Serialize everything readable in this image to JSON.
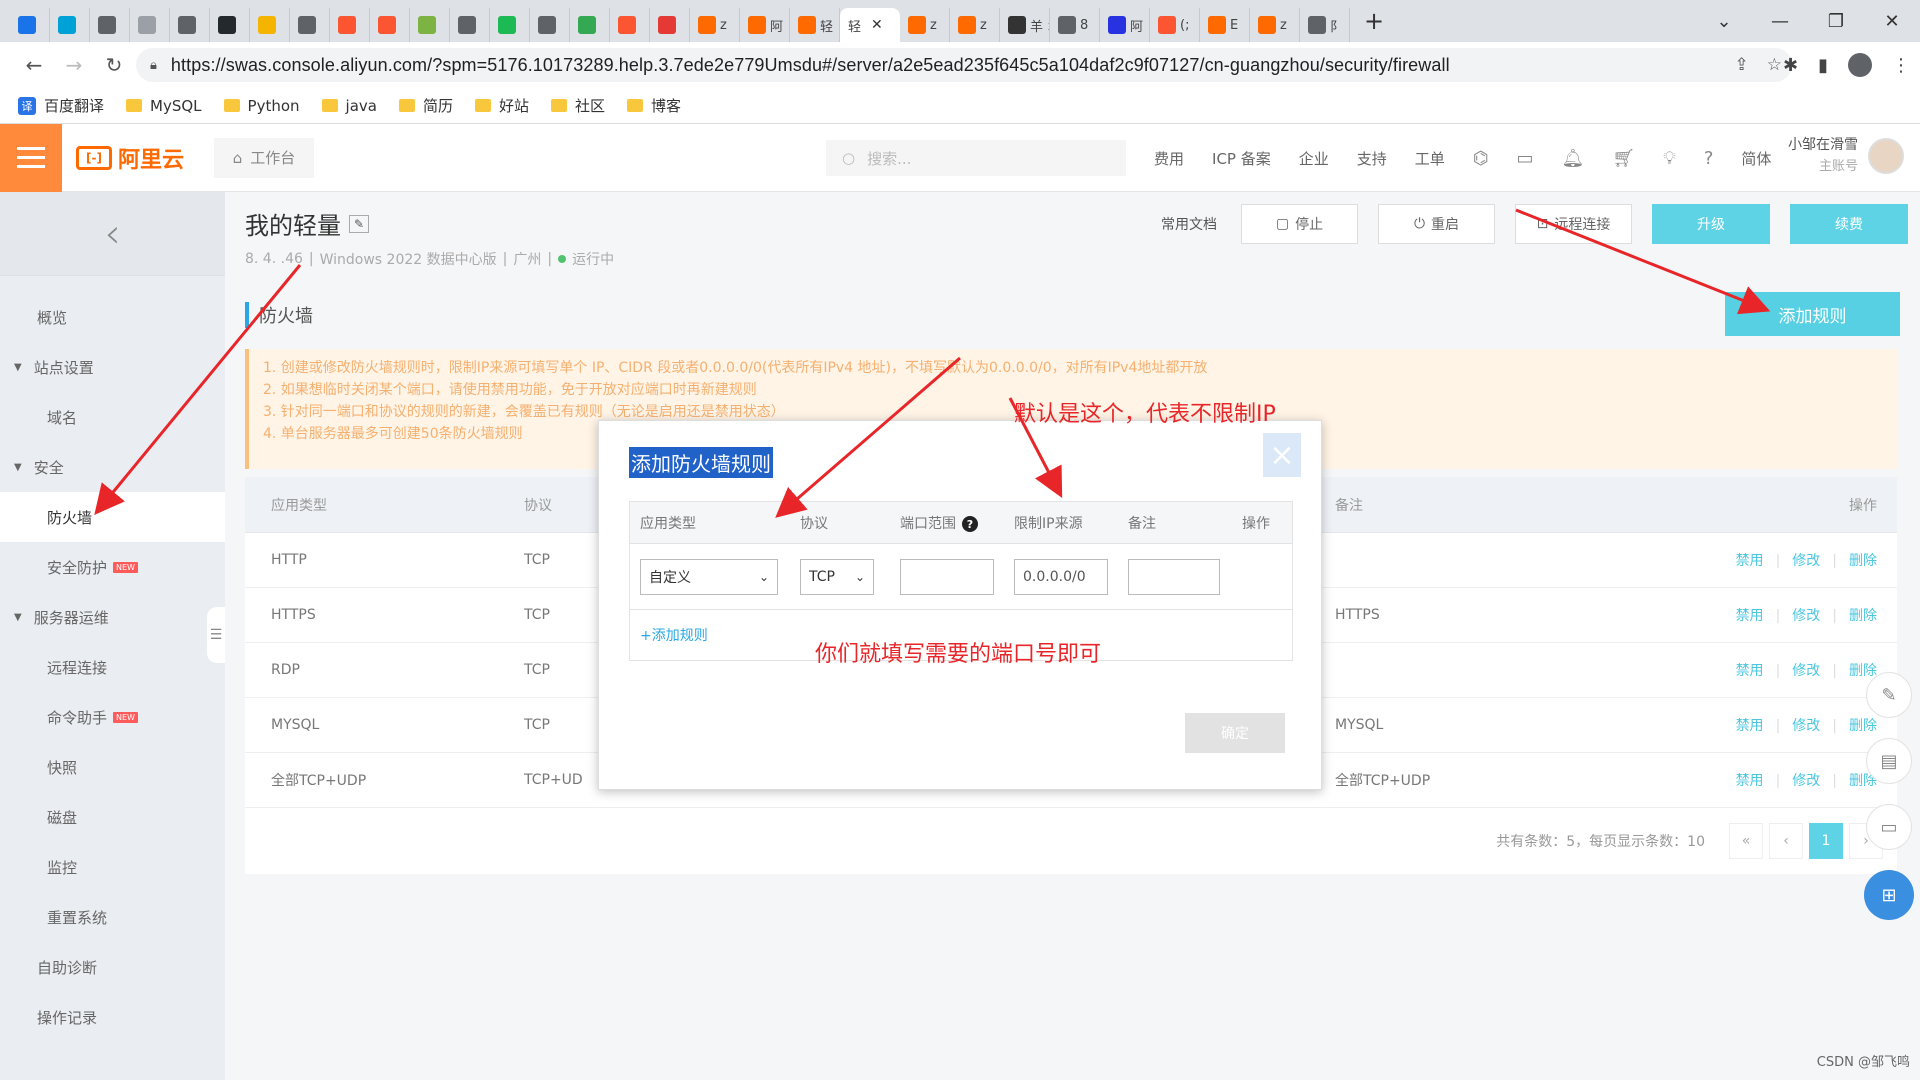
{
  "browser": {
    "tabs": [
      {
        "icon": "translate-icon",
        "label": "",
        "color": "#1a73e8"
      },
      {
        "icon": "bilibili-icon",
        "label": "",
        "color": "#00a1d6"
      },
      {
        "icon": "globe-icon",
        "label": "",
        "color": "#5f6368"
      },
      {
        "icon": "upload-icon",
        "label": "",
        "color": "#9aa0a6"
      },
      {
        "icon": "app-icon",
        "label": "",
        "color": "#5f6368"
      },
      {
        "icon": "github-icon",
        "label": "",
        "color": "#24292e"
      },
      {
        "icon": "bag-icon",
        "label": "",
        "color": "#f4b400"
      },
      {
        "icon": "pen-icon",
        "label": "",
        "color": "#5f6368"
      },
      {
        "icon": "csdn-icon",
        "label": "",
        "color": "#fc5531"
      },
      {
        "icon": "csdn-icon",
        "label": "",
        "color": "#fc5531"
      },
      {
        "icon": "ball-icon",
        "label": "",
        "color": "#7cb342"
      },
      {
        "icon": "image-icon",
        "label": "",
        "color": "#5f6368"
      },
      {
        "icon": "refresh-icon",
        "label": "",
        "color": "#1db954"
      },
      {
        "icon": "app-icon",
        "label": "",
        "color": "#5f6368"
      },
      {
        "icon": "leaf-icon",
        "label": "",
        "color": "#34a853"
      },
      {
        "icon": "csdn-icon",
        "label": "",
        "color": "#fc5531"
      },
      {
        "icon": "doc-icon",
        "label": "",
        "color": "#e53935"
      },
      {
        "icon": "aliyun-icon",
        "label": "z",
        "color": "#ff6a00"
      },
      {
        "icon": "aliyun-icon",
        "label": "阿",
        "color": "#ff6a00"
      },
      {
        "icon": "aliyun-icon",
        "label": "轻",
        "color": "#ff6a00"
      },
      {
        "icon": "",
        "label": "轻",
        "color": "#ffffff",
        "active": true
      },
      {
        "icon": "aliyun-icon",
        "label": "z",
        "color": "#ff6a00"
      },
      {
        "icon": "aliyun-icon",
        "label": "z",
        "color": "#ff6a00"
      },
      {
        "icon": "sheep-icon",
        "label": "羊 オ",
        "color": "#333333"
      },
      {
        "icon": "globe-icon",
        "label": "8",
        "color": "#5f6368"
      },
      {
        "icon": "baidu-icon",
        "label": "阿",
        "color": "#2932e1"
      },
      {
        "icon": "csdn-icon",
        "label": "(;",
        "color": "#fc5531"
      },
      {
        "icon": "aliyun-icon",
        "label": "E",
        "color": "#ff6a00"
      },
      {
        "icon": "aliyun-icon",
        "label": "z",
        "color": "#ff6a00"
      },
      {
        "icon": "globe-icon",
        "label": "阝",
        "color": "#5f6368"
      }
    ],
    "new_tab": "+",
    "url": "https://swas.console.aliyun.com/?spm=5176.10173289.help.3.7ede2e779Umsdu#/server/a2e5ead235f645c5a104daf2c9f07127/cn-guangzhou/security/firewall",
    "bookmarks": [
      {
        "label": "百度翻译",
        "type": "app"
      },
      {
        "label": "MySQL",
        "type": "folder"
      },
      {
        "label": "Python",
        "type": "folder"
      },
      {
        "label": "java",
        "type": "folder"
      },
      {
        "label": "简历",
        "type": "folder"
      },
      {
        "label": "好站",
        "type": "folder"
      },
      {
        "label": "社区",
        "type": "folder"
      },
      {
        "label": "博客",
        "type": "folder"
      }
    ]
  },
  "header": {
    "logo_text": "阿里云",
    "workbench": "工作台",
    "search_placeholder": "搜索...",
    "nav": [
      "费用",
      "ICP 备案",
      "企业",
      "支持",
      "工单"
    ],
    "lang": "简体",
    "user_name": "小邹在滑雪",
    "user_role": "主账号"
  },
  "sidebar": {
    "items": [
      {
        "label": "概览",
        "kind": "item"
      },
      {
        "label": "站点设置",
        "kind": "group"
      },
      {
        "label": "域名",
        "kind": "sub"
      },
      {
        "label": "安全",
        "kind": "group"
      },
      {
        "label": "防火墙",
        "kind": "sub",
        "active": true
      },
      {
        "label": "安全防护",
        "kind": "sub",
        "badge": "NEW"
      },
      {
        "label": "服务器运维",
        "kind": "group"
      },
      {
        "label": "远程连接",
        "kind": "sub"
      },
      {
        "label": "命令助手",
        "kind": "sub",
        "badge": "NEW"
      },
      {
        "label": "快照",
        "kind": "sub"
      },
      {
        "label": "磁盘",
        "kind": "sub"
      },
      {
        "label": "监控",
        "kind": "sub"
      },
      {
        "label": "重置系统",
        "kind": "sub"
      },
      {
        "label": "自助诊断",
        "kind": "item"
      },
      {
        "label": "操作记录",
        "kind": "item"
      }
    ]
  },
  "page": {
    "title": "我的轻量",
    "ip_masked": "8.  4.  .46",
    "os": "Windows 2022 数据中心版",
    "region": "广州",
    "status": "运行中",
    "doc_link": "常用文档",
    "buttons": {
      "stop": "停止",
      "restart": "重启",
      "remote": "远程连接",
      "upgrade": "升级",
      "renew": "续费"
    },
    "section_title": "防火墙",
    "add_rule_button": "添加规则",
    "notice": [
      "1. 创建或修改防火墙规则时，限制IP来源可填写单个 IP、CIDR 段或者0.0.0.0/0(代表所有IPv4 地址)，不填写默认为0.0.0.0/0，对所有IPv4地址都开放",
      "2. 如果想临时关闭某个端口，请使用禁用功能，免于开放对应端口时再新建规则",
      "3. 针对同一端口和协议的规则的新建，会覆盖已有规则（无论是启用还是禁用状态）",
      "4. 单台服务器最多可创建50条防火墙规则"
    ],
    "table": {
      "headers": [
        "应用类型",
        "协议",
        "备注",
        "操作"
      ],
      "rows": [
        {
          "type": "HTTP",
          "proto": "TCP",
          "note": ""
        },
        {
          "type": "HTTPS",
          "proto": "TCP",
          "note": "HTTPS"
        },
        {
          "type": "RDP",
          "proto": "TCP",
          "note": ""
        },
        {
          "type": "MYSQL",
          "proto": "TCP",
          "note": "MYSQL"
        },
        {
          "type": "全部TCP+UDP",
          "proto": "TCP+UD",
          "note": "全部TCP+UDP"
        }
      ],
      "actions": [
        "禁用",
        "修改",
        "删除"
      ]
    },
    "pagination": {
      "info": "共有条数：5，每页显示条数：10",
      "first": "«",
      "prev": "‹",
      "current": "1",
      "next": "›"
    }
  },
  "modal": {
    "title": "添加防火墙规则",
    "close": "×",
    "headers": {
      "type": "应用类型",
      "proto": "协议",
      "port": "端口范围",
      "ip": "限制IP来源",
      "note": "备注",
      "op": "操作"
    },
    "row": {
      "type": "自定义",
      "proto": "TCP",
      "port": "",
      "ip": "0.0.0.0/0",
      "note": ""
    },
    "add_link": "+添加规则",
    "confirm": "确定"
  },
  "annotations": {
    "ip_note": "默认是这个，代表不限制IP",
    "port_note": "你们就填写需要的端口号即可"
  },
  "watermark": "CSDN @邹飞鸣",
  "colors": {
    "accent": "#5fd3e6",
    "brand": "#ff6a00",
    "annotation": "#e8262a",
    "link": "#2aa8e5"
  }
}
